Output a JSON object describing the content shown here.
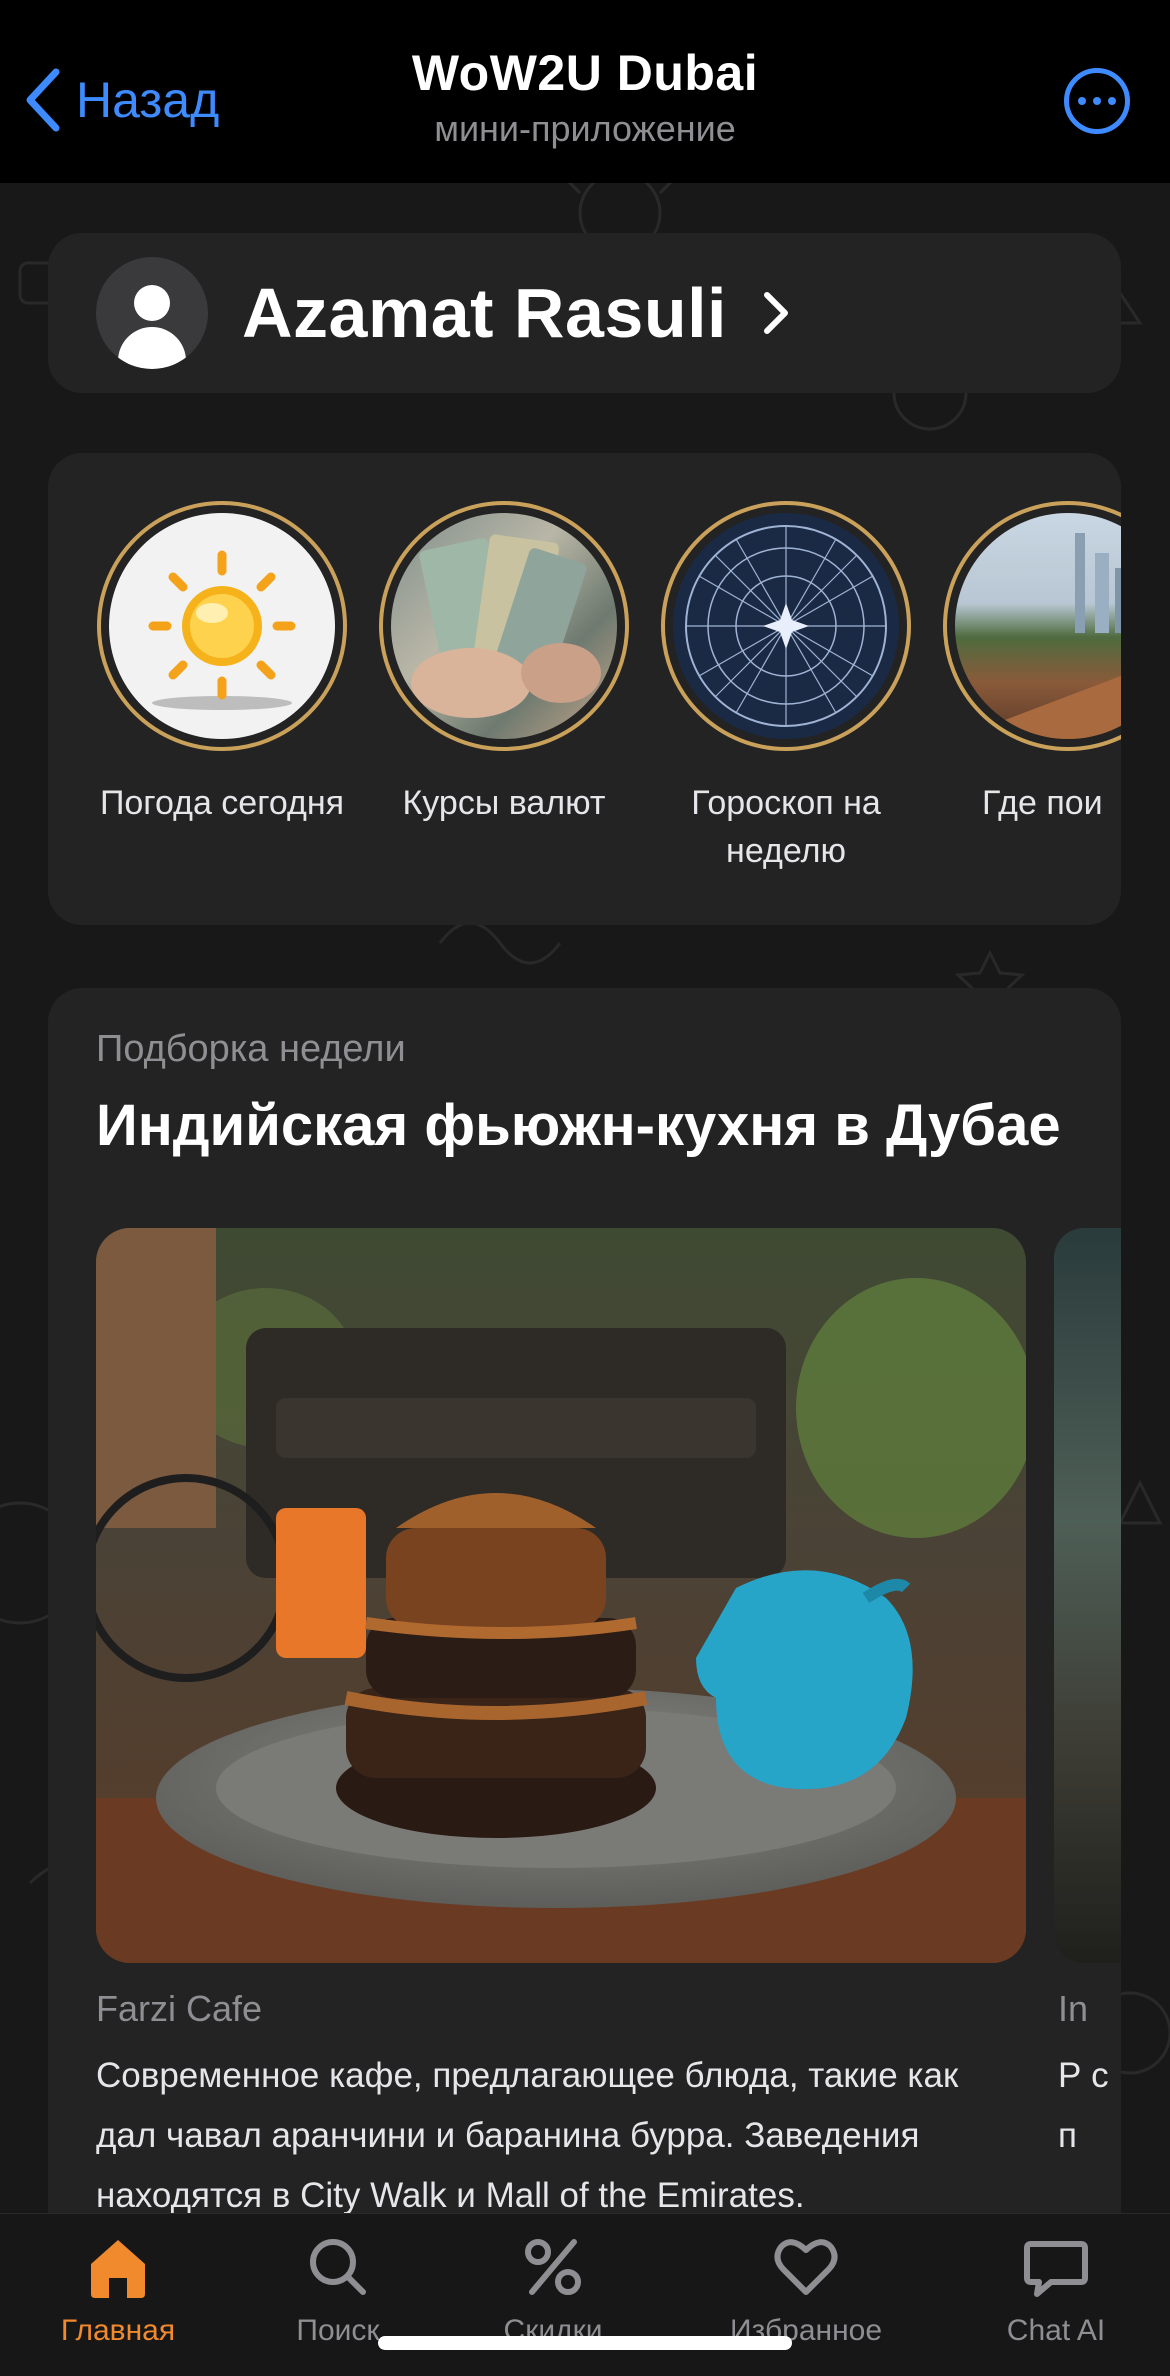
{
  "header": {
    "back_label": "Назад",
    "title": "WoW2U Dubai",
    "subtitle": "мини-приложение"
  },
  "profile": {
    "name": "Azamat Rasuli"
  },
  "stories": [
    {
      "label": "Погода сегодня",
      "icon": "sun-icon"
    },
    {
      "label": "Курсы валют",
      "icon": "money-icon"
    },
    {
      "label": "Гороскоп на неделю",
      "icon": "zodiac-icon"
    },
    {
      "label": "Где пои",
      "icon": "city-icon"
    }
  ],
  "feature": {
    "kicker": "Подборка недели",
    "title": "Индийская фьюжн-кухня в Дубае",
    "cards": [
      {
        "place": "Farzi Cafe",
        "description": "Современное кафе, предлагающее блюда, такие как дал чавал аранчини и баранина бурра. Заведения находятся в City Walk и Mall of the Emirates."
      },
      {
        "place": "In",
        "description": "Р с п"
      }
    ]
  },
  "tabs": [
    {
      "label": "Главная",
      "icon": "home-icon",
      "active": true
    },
    {
      "label": "Поиск",
      "icon": "search-icon",
      "active": false
    },
    {
      "label": "Скидки",
      "icon": "percent-icon",
      "active": false
    },
    {
      "label": "Избранное",
      "icon": "heart-icon",
      "active": false
    },
    {
      "label": "Chat AI",
      "icon": "chat-icon",
      "active": false
    }
  ],
  "colors": {
    "accent_blue": "#3e8bff",
    "accent_orange": "#f08a2c",
    "story_ring": "#c9a15a",
    "card_bg": "#232323"
  }
}
